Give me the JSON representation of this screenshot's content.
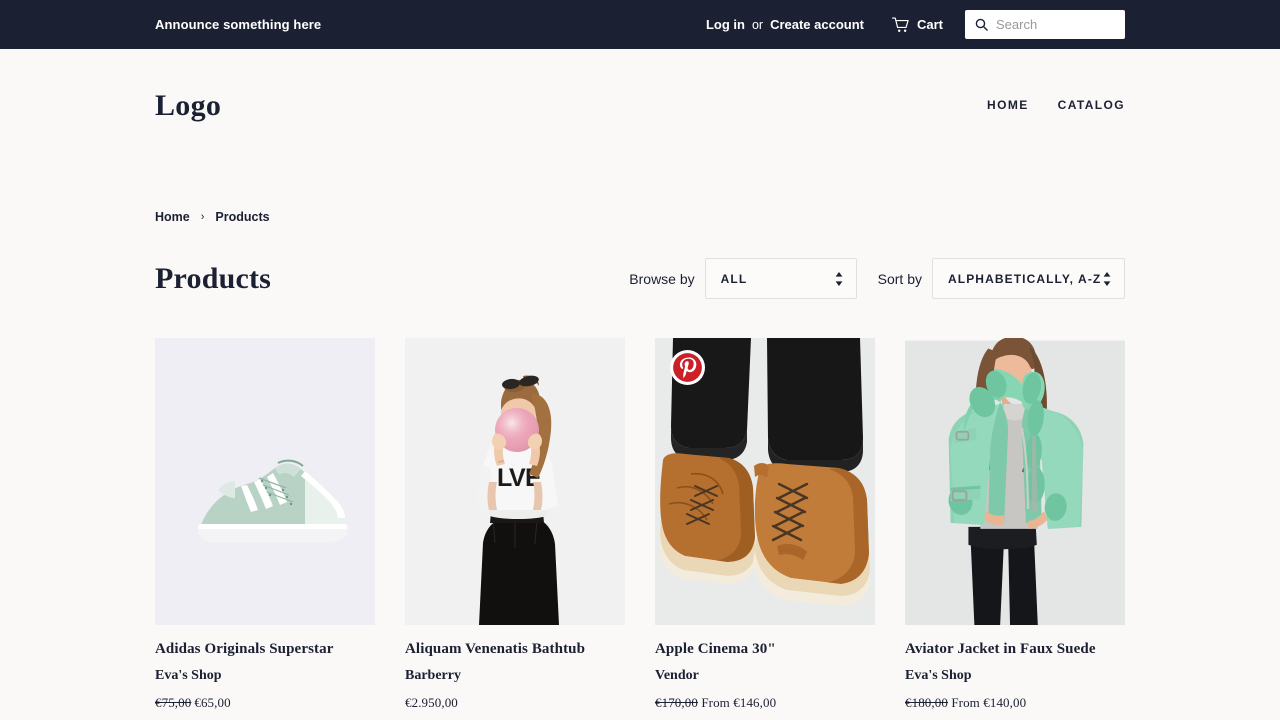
{
  "announcement": {
    "text": "Announce something here",
    "login_label": "Log in",
    "or_label": "or",
    "create_account_label": "Create account",
    "cart_label": "Cart",
    "cart_icon": "shopping-cart-icon",
    "search_icon": "search-icon",
    "search_placeholder": "Search",
    "search_value": "",
    "background_color": "#1c2033"
  },
  "header": {
    "logo": "Logo",
    "nav": [
      {
        "label": "HOME"
      },
      {
        "label": "CATALOG"
      }
    ]
  },
  "breadcrumb": {
    "home": "Home",
    "separator": "›",
    "current": "Products"
  },
  "collection": {
    "title": "Products",
    "browse_label": "Browse by",
    "browse_value": "ALL",
    "sort_label": "Sort by",
    "sort_value": "ALPHABETICALLY, A-Z",
    "select_arrow_icon": "chevron-up-down-icon"
  },
  "products": [
    {
      "title": "Adidas Originals Superstar",
      "vendor": "Eva's Shop",
      "price_old": "€75,00",
      "price_new": "€65,00",
      "price_prefix": "",
      "on_sale": true,
      "pinterest_badge": false,
      "image_alt": "mint green adidas superstar sneaker on pale lavender background"
    },
    {
      "title": "Aliquam Venenatis Bathtub",
      "vendor": "Barberry",
      "price_old": "",
      "price_new": "€2.950,00",
      "price_prefix": "",
      "on_sale": false,
      "pinterest_badge": false,
      "image_alt": "model blowing pink balloon wearing white crop top and black leather skirt"
    },
    {
      "title": "Apple Cinema 30\"",
      "vendor": "Vendor",
      "price_old": "€170,00",
      "price_new": "€146,00",
      "price_prefix": "From",
      "on_sale": true,
      "pinterest_badge": true,
      "pinterest_icon": "pinterest-icon",
      "image_alt": "tan suede desert boots worn with black jeans"
    },
    {
      "title": "Aviator Jacket in Faux Suede",
      "vendor": "Eva's Shop",
      "price_old": "€180,00",
      "price_new": "€140,00",
      "price_prefix": "From",
      "on_sale": true,
      "pinterest_badge": false,
      "image_alt": "model wearing mint green faux suede aviator jacket"
    }
  ],
  "colors": {
    "page_background": "#faf9f7",
    "text": "#1c2033",
    "pinterest_red": "#cb2027",
    "border": "#e2e0dc"
  }
}
